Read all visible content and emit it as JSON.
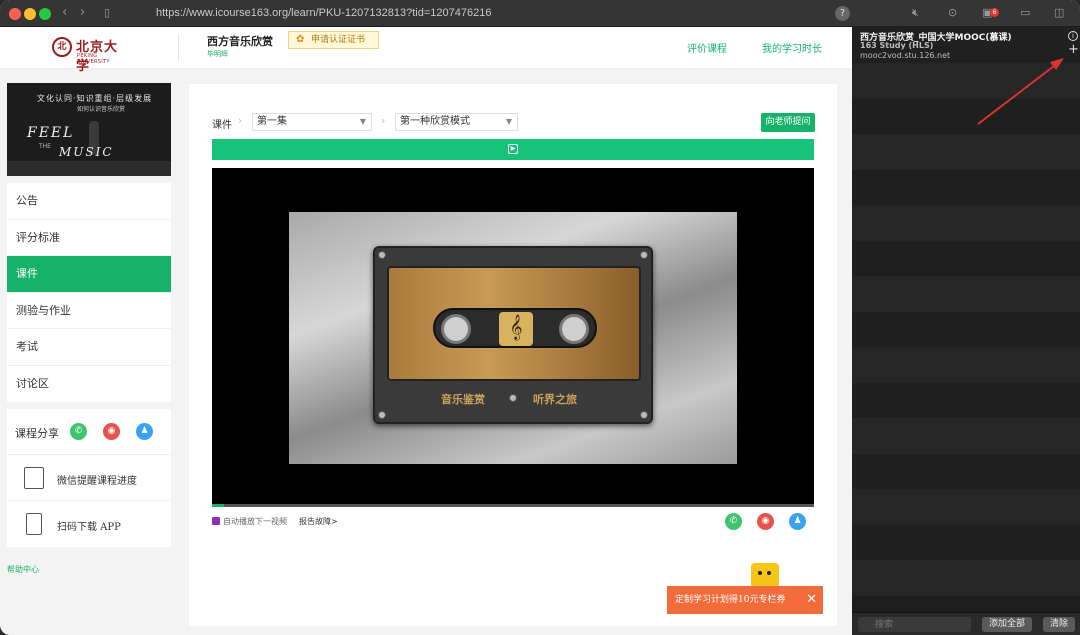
{
  "browser": {
    "url": "https://www.icourse163.org/learn/PKU-1207132813?tid=1207476216",
    "help_icon": "?",
    "notification_count": "6",
    "icons": [
      "back-icon",
      "forward-icon",
      "sidebar-toggle-icon",
      "mute-icon",
      "play-circle-icon",
      "picture-icon",
      "chat-icon",
      "split-view-icon"
    ]
  },
  "header": {
    "logo_cn": "北京大学",
    "logo_en": "PEKING UNIVERSITY",
    "course_title": "西方音乐欣赏",
    "teacher": "毕明辉",
    "cert_label": "申请认证证书",
    "link_review": "评价课程",
    "link_time": "我的学习时长"
  },
  "sidebar": {
    "thumb_line1": "文化认同·知识重组·层级发展",
    "thumb_line2": "如何认识音乐欣赏",
    "thumb_feel": "FEEL",
    "thumb_the": "THE",
    "thumb_music": "MUSIC",
    "nav": [
      "公告",
      "评分标准",
      "课件",
      "测验与作业",
      "考试",
      "讨论区"
    ],
    "active_index": 2,
    "share_label": "课程分享",
    "wechat_remind": "微信提醒课程进度",
    "scan_download": "扫码下载 APP",
    "help_center": "帮助中心"
  },
  "main": {
    "crumb_label": "课件",
    "select_episode": "第一集",
    "select_mode": "第一种欣赏模式",
    "ask_teacher": "向老师提问",
    "video_text_left": "音乐鉴赏",
    "video_text_right": "听界之旅",
    "progress": 0.02,
    "autoplay_label": "自动播放下一视频",
    "report_label": "报告故障>"
  },
  "promo": {
    "text": "定制学习计划得10元专栏券",
    "close": "✕"
  },
  "pane": {
    "title": "西方音乐欣赏_中国大学MOOC(慕课)",
    "subtitle": "163 Study (HLS)",
    "host": "mooc2vod.stu.126.net",
    "search_placeholder": "搜索",
    "add_all": "添加全部",
    "clear": "清除"
  },
  "colors": {
    "accent": "#17b26a",
    "promo": "#f26b3a",
    "pku_red": "#9b1b1b",
    "annotation_arrow": "#d9342b"
  }
}
